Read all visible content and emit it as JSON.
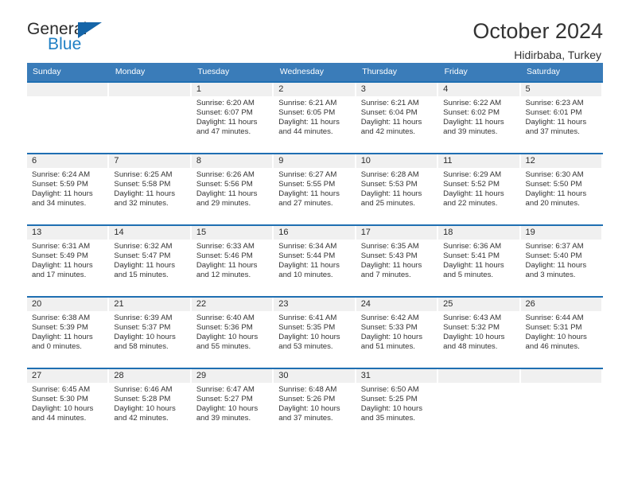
{
  "brand": {
    "name_top": "General",
    "name_bottom": "Blue",
    "accent_color": "#1f7fc4",
    "triangle_color": "#1565a8"
  },
  "header": {
    "title": "October 2024",
    "subtitle": "Hidirbaba, Turkey"
  },
  "calendar": {
    "header_bg": "#3A7CB9",
    "row_divider_color": "#1F6FB2",
    "daynum_band_color": "#f0f0f0",
    "weekdays": [
      "Sunday",
      "Monday",
      "Tuesday",
      "Wednesday",
      "Thursday",
      "Friday",
      "Saturday"
    ],
    "weeks": [
      [
        {
          "day": "",
          "sunrise": "",
          "sunset": "",
          "daylight_1": "",
          "daylight_2": "",
          "empty": true
        },
        {
          "day": "",
          "sunrise": "",
          "sunset": "",
          "daylight_1": "",
          "daylight_2": "",
          "empty": true
        },
        {
          "day": "1",
          "sunrise": "Sunrise: 6:20 AM",
          "sunset": "Sunset: 6:07 PM",
          "daylight_1": "Daylight: 11 hours",
          "daylight_2": "and 47 minutes."
        },
        {
          "day": "2",
          "sunrise": "Sunrise: 6:21 AM",
          "sunset": "Sunset: 6:05 PM",
          "daylight_1": "Daylight: 11 hours",
          "daylight_2": "and 44 minutes."
        },
        {
          "day": "3",
          "sunrise": "Sunrise: 6:21 AM",
          "sunset": "Sunset: 6:04 PM",
          "daylight_1": "Daylight: 11 hours",
          "daylight_2": "and 42 minutes."
        },
        {
          "day": "4",
          "sunrise": "Sunrise: 6:22 AM",
          "sunset": "Sunset: 6:02 PM",
          "daylight_1": "Daylight: 11 hours",
          "daylight_2": "and 39 minutes."
        },
        {
          "day": "5",
          "sunrise": "Sunrise: 6:23 AM",
          "sunset": "Sunset: 6:01 PM",
          "daylight_1": "Daylight: 11 hours",
          "daylight_2": "and 37 minutes."
        }
      ],
      [
        {
          "day": "6",
          "sunrise": "Sunrise: 6:24 AM",
          "sunset": "Sunset: 5:59 PM",
          "daylight_1": "Daylight: 11 hours",
          "daylight_2": "and 34 minutes."
        },
        {
          "day": "7",
          "sunrise": "Sunrise: 6:25 AM",
          "sunset": "Sunset: 5:58 PM",
          "daylight_1": "Daylight: 11 hours",
          "daylight_2": "and 32 minutes."
        },
        {
          "day": "8",
          "sunrise": "Sunrise: 6:26 AM",
          "sunset": "Sunset: 5:56 PM",
          "daylight_1": "Daylight: 11 hours",
          "daylight_2": "and 29 minutes."
        },
        {
          "day": "9",
          "sunrise": "Sunrise: 6:27 AM",
          "sunset": "Sunset: 5:55 PM",
          "daylight_1": "Daylight: 11 hours",
          "daylight_2": "and 27 minutes."
        },
        {
          "day": "10",
          "sunrise": "Sunrise: 6:28 AM",
          "sunset": "Sunset: 5:53 PM",
          "daylight_1": "Daylight: 11 hours",
          "daylight_2": "and 25 minutes."
        },
        {
          "day": "11",
          "sunrise": "Sunrise: 6:29 AM",
          "sunset": "Sunset: 5:52 PM",
          "daylight_1": "Daylight: 11 hours",
          "daylight_2": "and 22 minutes."
        },
        {
          "day": "12",
          "sunrise": "Sunrise: 6:30 AM",
          "sunset": "Sunset: 5:50 PM",
          "daylight_1": "Daylight: 11 hours",
          "daylight_2": "and 20 minutes."
        }
      ],
      [
        {
          "day": "13",
          "sunrise": "Sunrise: 6:31 AM",
          "sunset": "Sunset: 5:49 PM",
          "daylight_1": "Daylight: 11 hours",
          "daylight_2": "and 17 minutes."
        },
        {
          "day": "14",
          "sunrise": "Sunrise: 6:32 AM",
          "sunset": "Sunset: 5:47 PM",
          "daylight_1": "Daylight: 11 hours",
          "daylight_2": "and 15 minutes."
        },
        {
          "day": "15",
          "sunrise": "Sunrise: 6:33 AM",
          "sunset": "Sunset: 5:46 PM",
          "daylight_1": "Daylight: 11 hours",
          "daylight_2": "and 12 minutes."
        },
        {
          "day": "16",
          "sunrise": "Sunrise: 6:34 AM",
          "sunset": "Sunset: 5:44 PM",
          "daylight_1": "Daylight: 11 hours",
          "daylight_2": "and 10 minutes."
        },
        {
          "day": "17",
          "sunrise": "Sunrise: 6:35 AM",
          "sunset": "Sunset: 5:43 PM",
          "daylight_1": "Daylight: 11 hours",
          "daylight_2": "and 7 minutes."
        },
        {
          "day": "18",
          "sunrise": "Sunrise: 6:36 AM",
          "sunset": "Sunset: 5:41 PM",
          "daylight_1": "Daylight: 11 hours",
          "daylight_2": "and 5 minutes."
        },
        {
          "day": "19",
          "sunrise": "Sunrise: 6:37 AM",
          "sunset": "Sunset: 5:40 PM",
          "daylight_1": "Daylight: 11 hours",
          "daylight_2": "and 3 minutes."
        }
      ],
      [
        {
          "day": "20",
          "sunrise": "Sunrise: 6:38 AM",
          "sunset": "Sunset: 5:39 PM",
          "daylight_1": "Daylight: 11 hours",
          "daylight_2": "and 0 minutes."
        },
        {
          "day": "21",
          "sunrise": "Sunrise: 6:39 AM",
          "sunset": "Sunset: 5:37 PM",
          "daylight_1": "Daylight: 10 hours",
          "daylight_2": "and 58 minutes."
        },
        {
          "day": "22",
          "sunrise": "Sunrise: 6:40 AM",
          "sunset": "Sunset: 5:36 PM",
          "daylight_1": "Daylight: 10 hours",
          "daylight_2": "and 55 minutes."
        },
        {
          "day": "23",
          "sunrise": "Sunrise: 6:41 AM",
          "sunset": "Sunset: 5:35 PM",
          "daylight_1": "Daylight: 10 hours",
          "daylight_2": "and 53 minutes."
        },
        {
          "day": "24",
          "sunrise": "Sunrise: 6:42 AM",
          "sunset": "Sunset: 5:33 PM",
          "daylight_1": "Daylight: 10 hours",
          "daylight_2": "and 51 minutes."
        },
        {
          "day": "25",
          "sunrise": "Sunrise: 6:43 AM",
          "sunset": "Sunset: 5:32 PM",
          "daylight_1": "Daylight: 10 hours",
          "daylight_2": "and 48 minutes."
        },
        {
          "day": "26",
          "sunrise": "Sunrise: 6:44 AM",
          "sunset": "Sunset: 5:31 PM",
          "daylight_1": "Daylight: 10 hours",
          "daylight_2": "and 46 minutes."
        }
      ],
      [
        {
          "day": "27",
          "sunrise": "Sunrise: 6:45 AM",
          "sunset": "Sunset: 5:30 PM",
          "daylight_1": "Daylight: 10 hours",
          "daylight_2": "and 44 minutes."
        },
        {
          "day": "28",
          "sunrise": "Sunrise: 6:46 AM",
          "sunset": "Sunset: 5:28 PM",
          "daylight_1": "Daylight: 10 hours",
          "daylight_2": "and 42 minutes."
        },
        {
          "day": "29",
          "sunrise": "Sunrise: 6:47 AM",
          "sunset": "Sunset: 5:27 PM",
          "daylight_1": "Daylight: 10 hours",
          "daylight_2": "and 39 minutes."
        },
        {
          "day": "30",
          "sunrise": "Sunrise: 6:48 AM",
          "sunset": "Sunset: 5:26 PM",
          "daylight_1": "Daylight: 10 hours",
          "daylight_2": "and 37 minutes."
        },
        {
          "day": "31",
          "sunrise": "Sunrise: 6:50 AM",
          "sunset": "Sunset: 5:25 PM",
          "daylight_1": "Daylight: 10 hours",
          "daylight_2": "and 35 minutes."
        },
        {
          "day": "",
          "sunrise": "",
          "sunset": "",
          "daylight_1": "",
          "daylight_2": "",
          "empty": true
        },
        {
          "day": "",
          "sunrise": "",
          "sunset": "",
          "daylight_1": "",
          "daylight_2": "",
          "empty": true
        }
      ]
    ]
  }
}
